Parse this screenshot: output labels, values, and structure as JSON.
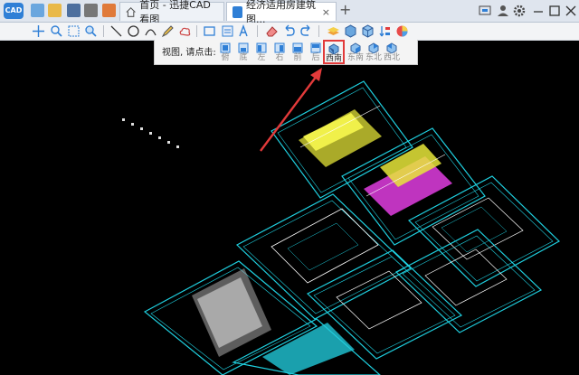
{
  "app": {
    "logo_text": "CAD"
  },
  "tabs": [
    {
      "label": "首页 - 迅捷CAD看图",
      "close": "×"
    },
    {
      "label": "经济适用房建筑图...",
      "close": "×"
    }
  ],
  "tab_add": "+",
  "view_bar": {
    "label": "视图, 请点击:",
    "views": [
      "俯",
      "底",
      "左",
      "右",
      "前",
      "后",
      "西南",
      "东南",
      "东北",
      "西北"
    ],
    "selected": "西南"
  },
  "colors": {
    "canvas_bg": "#000000",
    "frame_cyan": "#1fd0e0",
    "highlight_red": "#e23a3a",
    "plan_yellow": "#e8e83a",
    "plan_magenta": "#d43ad4"
  },
  "icons": {
    "quick_access": [
      "open-file-icon",
      "open-folder-icon",
      "save-icon",
      "print-icon",
      "export-icon"
    ],
    "toolbar": [
      "pan-icon",
      "zoom-window-icon",
      "zoom-extents-icon",
      "zoom-realtime-icon",
      "line-icon",
      "circle-icon",
      "arc-icon",
      "pencil-icon",
      "cloud-icon",
      "rectangle-icon",
      "text-frame-icon",
      "text-icon",
      "eraser-icon",
      "undo-icon",
      "redo-icon",
      "layer-icon",
      "3d-box-icon",
      "3d-box-color-icon",
      "sort-icon",
      "render-sphere-icon"
    ]
  }
}
